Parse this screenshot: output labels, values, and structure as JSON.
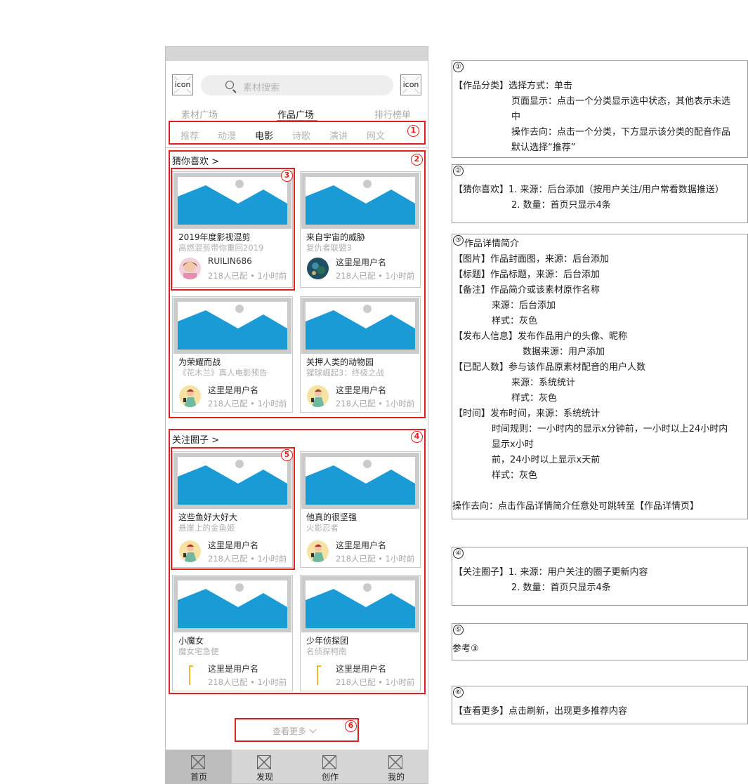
{
  "header": {
    "icon_left": "icon",
    "icon_right": "icon",
    "search_placeholder": "素材搜索"
  },
  "main_tabs": [
    {
      "label": "素材广场"
    },
    {
      "label": "作品广场",
      "active": true
    },
    {
      "label": "排行榜单"
    }
  ],
  "categories": [
    "推荐",
    "动漫",
    "电影",
    "诗歌",
    "演讲",
    "网文"
  ],
  "active_category": "电影",
  "guess": {
    "title": "猜你喜欢 >",
    "cards": [
      {
        "title": "2019年度影视混剪",
        "subtitle": "高燃混剪带你重回2019",
        "user": "RUILIN686",
        "meta": "218人已配 • 1小时前"
      },
      {
        "title": "来自宇宙的威胁",
        "subtitle": "复仇者联盟3",
        "user": "这里是用户名",
        "meta": "218人已配 • 1小时前"
      },
      {
        "title": "为荣耀而战",
        "subtitle": "《花木兰》真人电影预告",
        "user": "这里是用户名",
        "meta": "218人已配 • 1小时前"
      },
      {
        "title": "关押人类的动物园",
        "subtitle": "猩球崛起3：终极之战",
        "user": "这里是用户名",
        "meta": "218人已配 • 1小时前"
      }
    ]
  },
  "follow": {
    "title": "关注圈子 >",
    "cards": [
      {
        "title": "这些鱼好大好大",
        "subtitle": "悬崖上的金鱼姬",
        "user": "这里是用户名",
        "meta": "218人已配 • 1小时前"
      },
      {
        "title": "他真的很坚强",
        "subtitle": "火影忍者",
        "user": "这里是用户名",
        "meta": "218人已配 • 1小时前"
      },
      {
        "title": "小魔女",
        "subtitle": "魔女宅急便",
        "user": "这里是用户名",
        "meta": "218人已配 • 1小时前"
      },
      {
        "title": "少年侦探团",
        "subtitle": "名侦探柯南",
        "user": "这里是用户名",
        "meta": "218人已配 • 1小时前"
      }
    ]
  },
  "more_label": "查看更多",
  "bottom_nav": [
    {
      "label": "首页",
      "active": true
    },
    {
      "label": "发现"
    },
    {
      "label": "创作"
    },
    {
      "label": "我的"
    }
  ],
  "markers": [
    "1",
    "2",
    "3",
    "4",
    "5",
    "6"
  ],
  "notes": [
    {
      "num": "①",
      "lines": [
        "【作品分类】选择方式：单击",
        "页面显示：点击一个分类显示选中状态，其他表示未选",
        "中",
        "操作去向：点击一个分类，下方显示该分类的配音作品",
        "默认选择“推荐”"
      ]
    },
    {
      "num": "②",
      "lines": [
        "【猜你喜欢】1. 来源：后台添加（按用户关注/用户常看数据推送）",
        "2. 数量：首页只显示4条"
      ]
    },
    {
      "num": "③",
      "lines": [
        "作品详情简介",
        "【图片】作品封面图，来源：后台添加",
        "【标题】作品标题，来源：后台添加",
        "【备注】作品简介或该素材原作名称",
        "来源：后台添加",
        "样式：灰色",
        "【发布人信息】发布作品用户的头像、昵称",
        "数据来源：用户添加",
        "【已配人数】参与该作品原素材配音的用户人数",
        "来源：系统统计",
        "样式：灰色",
        "【时间】发布时间，来源：系统统计",
        "时间规则：一小时内的显示x分钟前，一小时以上24小时内",
        "显示x小时",
        "前，24小时以上显示x天前",
        "样式：灰色",
        "操作去向：点击作品详情简介任意处可跳转至【作品详情页】"
      ]
    },
    {
      "num": "④",
      "lines": [
        "【关注圈子】1. 来源：用户关注的圈子更新内容",
        "2. 数量：首页只显示4条"
      ]
    },
    {
      "num": "⑤",
      "lines": [
        "参考③"
      ]
    },
    {
      "num": "⑥",
      "lines": [
        "【查看更多】点击刷新，出现更多推荐内容"
      ]
    }
  ],
  "colors": {
    "annotation_red": "#e02020",
    "image_blue": "#1b9bd5",
    "placeholder_gray": "#cbcbcb"
  },
  "icons": [
    "image-placeholder-icon",
    "search-icon",
    "chevron-down-icon",
    "nav-placeholder-icon"
  ]
}
